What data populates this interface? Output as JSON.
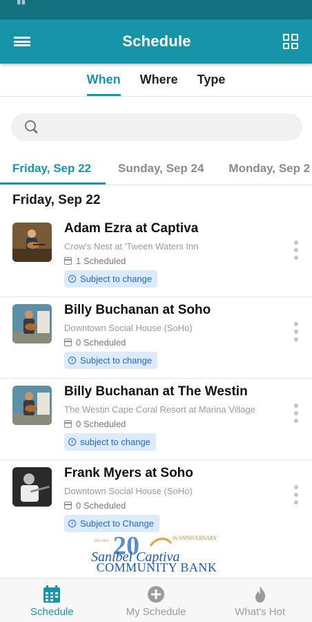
{
  "app": {
    "title": "Schedule",
    "accent_color": "#1894a8",
    "status_bar_color": "#13707f"
  },
  "filter_tabs": [
    {
      "label": "When",
      "active": true
    },
    {
      "label": "Where",
      "active": false
    },
    {
      "label": "Type",
      "active": false
    }
  ],
  "search": {
    "placeholder": "",
    "value": ""
  },
  "date_tabs": [
    {
      "label": "Friday, Sep 22",
      "active": true
    },
    {
      "label": "Sunday, Sep 24",
      "active": false
    },
    {
      "label": "Monday, Sep 2",
      "active": false
    }
  ],
  "day_header": "Friday, Sep 22",
  "events": [
    {
      "title": "Adam Ezra at Captiva",
      "venue": "Crow's Nest at 'Tween Waters Inn",
      "scheduled": "1 Scheduled",
      "badge": "Subject to change",
      "thumb": "guitarist-photo"
    },
    {
      "title": "Billy Buchanan at Soho",
      "venue": "Downtown Social House (SoHo)",
      "scheduled": "0 Scheduled",
      "badge": "Subject to change",
      "thumb": "guitarist-outdoor-photo"
    },
    {
      "title": "Billy Buchanan at The Westin",
      "venue": "The Westin Cape Coral Resort at Marina Village",
      "scheduled": "0 Scheduled",
      "badge": "subject to change",
      "thumb": "guitarist-outdoor-photo"
    },
    {
      "title": "Frank Myers at Soho",
      "venue": "Downtown Social House (SoHo)",
      "scheduled": "0 Scheduled",
      "badge": "Subject to Change",
      "thumb": "bw-guitarist-photo"
    }
  ],
  "sponsor": {
    "numeral": "20",
    "anniversary": "th ANNIVERSARY",
    "script_name": "Sanibel Captiva",
    "bank_name": "COMMUNITY BANK",
    "years": "2003 2023"
  },
  "bottom_nav": [
    {
      "label": "Schedule",
      "icon": "calendar-icon",
      "active": true
    },
    {
      "label": "My Schedule",
      "icon": "plus-circle-icon",
      "active": false
    },
    {
      "label": "What's Hot",
      "icon": "flame-icon",
      "active": false
    }
  ]
}
